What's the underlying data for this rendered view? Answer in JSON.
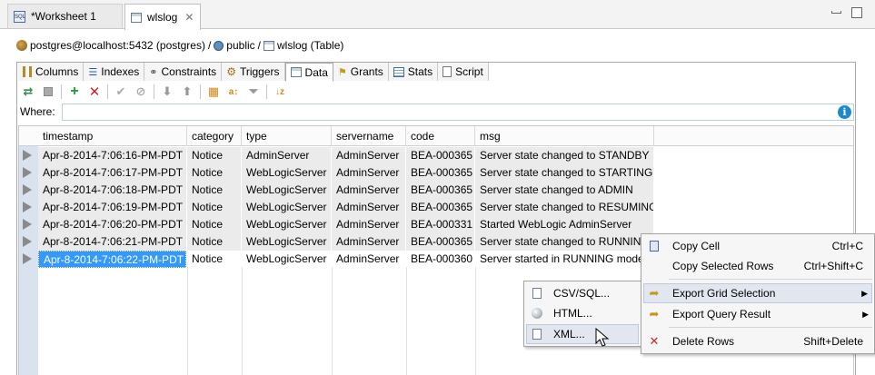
{
  "tabs": {
    "worksheet": "*Worksheet 1",
    "active": "wlslog"
  },
  "breadcrumb": {
    "connection": "postgres@localhost:5432 (postgres)",
    "sep1": "/",
    "schema": "public",
    "sep2": "/",
    "table": "wlslog (Table)"
  },
  "subtabs": [
    {
      "label": "Columns",
      "icon": "columns-icon"
    },
    {
      "label": "Indexes",
      "icon": "indexes-icon"
    },
    {
      "label": "Constraints",
      "icon": "constraints-icon"
    },
    {
      "label": "Triggers",
      "icon": "triggers-icon"
    },
    {
      "label": "Data",
      "icon": "data-icon"
    },
    {
      "label": "Grants",
      "icon": "grants-icon"
    },
    {
      "label": "Stats",
      "icon": "stats-icon"
    },
    {
      "label": "Script",
      "icon": "script-icon"
    }
  ],
  "where": {
    "label": "Where:",
    "value": ""
  },
  "grid": {
    "columns": [
      "timestamp",
      "category",
      "type",
      "servername",
      "code",
      "msg"
    ],
    "rows": [
      [
        "Apr-8-2014-7:06:16-PM-PDT",
        "Notice",
        "AdminServer",
        "AdminServer",
        "BEA-000365",
        "Server state changed to STANDBY"
      ],
      [
        "Apr-8-2014-7:06:17-PM-PDT",
        "Notice",
        "WebLogicServer",
        "AdminServer",
        "BEA-000365",
        "Server state changed to STARTING"
      ],
      [
        "Apr-8-2014-7:06:18-PM-PDT",
        "Notice",
        "WebLogicServer",
        "AdminServer",
        "BEA-000365",
        "Server state changed to ADMIN"
      ],
      [
        "Apr-8-2014-7:06:19-PM-PDT",
        "Notice",
        "WebLogicServer",
        "AdminServer",
        "BEA-000365",
        "Server state changed to RESUMING"
      ],
      [
        "Apr-8-2014-7:06:20-PM-PDT",
        "Notice",
        "WebLogicServer",
        "AdminServer",
        "BEA-000331",
        "Started WebLogic AdminServer"
      ],
      [
        "Apr-8-2014-7:06:21-PM-PDT",
        "Notice",
        "WebLogicServer",
        "AdminServer",
        "BEA-000365",
        "Server state changed to RUNNING"
      ],
      [
        "Apr-8-2014-7:06:22-PM-PDT",
        "Notice",
        "WebLogicServer",
        "AdminServer",
        "BEA-000360",
        "Server started in RUNNING mode"
      ]
    ]
  },
  "context_menu": {
    "copy_cell": "Copy Cell",
    "copy_cell_shortcut": "Ctrl+C",
    "copy_rows": "Copy Selected Rows",
    "copy_rows_shortcut": "Ctrl+Shift+C",
    "export_grid": "Export Grid Selection",
    "export_query": "Export Query Result",
    "delete_rows": "Delete Rows",
    "delete_rows_shortcut": "Shift+Delete"
  },
  "submenu": {
    "csv": "CSV/SQL...",
    "html": "HTML...",
    "xml": "XML..."
  }
}
